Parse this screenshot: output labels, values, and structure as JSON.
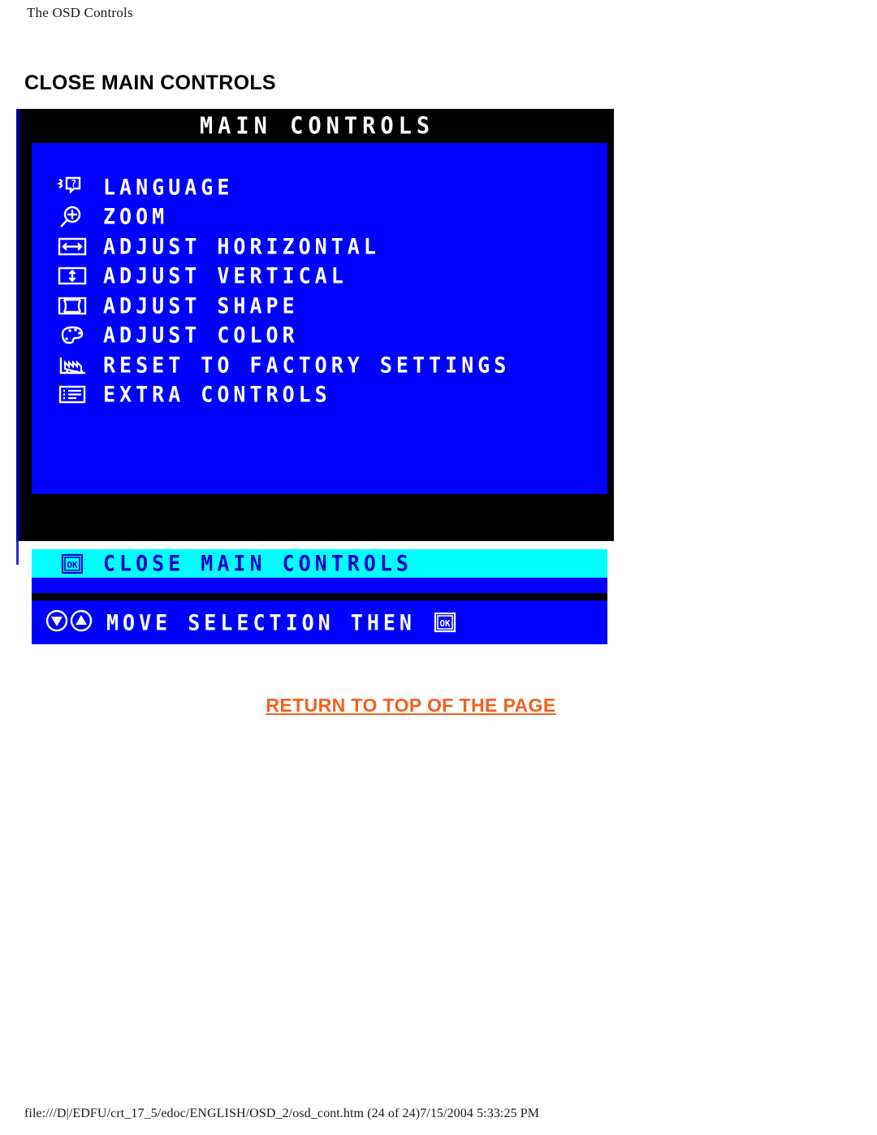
{
  "page": {
    "running_header": "The OSD Controls",
    "heading": "CLOSE MAIN CONTROLS",
    "return_link": "RETURN TO TOP OF THE PAGE",
    "footer": "file:///D|/EDFU/crt_17_5/edoc/ENGLISH/OSD_2/osd_cont.htm (24 of 24)7/15/2004 5:33:25 PM"
  },
  "osd": {
    "title": "MAIN CONTROLS",
    "colors": {
      "panel_blue": "#0000FF",
      "highlight_cyan": "#00FFFF",
      "frame_black": "#000000",
      "text_white": "#FFFFFF",
      "highlight_text_blue": "#0000CC",
      "link_orange": "#F4601E"
    },
    "items": [
      {
        "icon": "language-globe-question-icon",
        "label": "LANGUAGE"
      },
      {
        "icon": "zoom-magnifier-plus-icon",
        "label": "ZOOM"
      },
      {
        "icon": "adjust-horizontal-arrows-icon",
        "label": "ADJUST HORIZONTAL"
      },
      {
        "icon": "adjust-vertical-arrows-icon",
        "label": "ADJUST VERTICAL"
      },
      {
        "icon": "adjust-shape-pincushion-icon",
        "label": "ADJUST SHAPE"
      },
      {
        "icon": "adjust-color-palette-icon",
        "label": "ADJUST COLOR"
      },
      {
        "icon": "reset-factory-icon",
        "label": "RESET TO FACTORY SETTINGS"
      },
      {
        "icon": "extra-controls-list-icon",
        "label": "EXTRA CONTROLS"
      }
    ],
    "selected": {
      "icon": "ok-button-icon",
      "label": "CLOSE MAIN CONTROLS"
    },
    "hint": {
      "down_icon": "arrow-down-round-icon",
      "up_icon": "arrow-up-round-icon",
      "label": "MOVE SELECTION THEN",
      "trailing_icon": "ok-button-icon"
    }
  }
}
